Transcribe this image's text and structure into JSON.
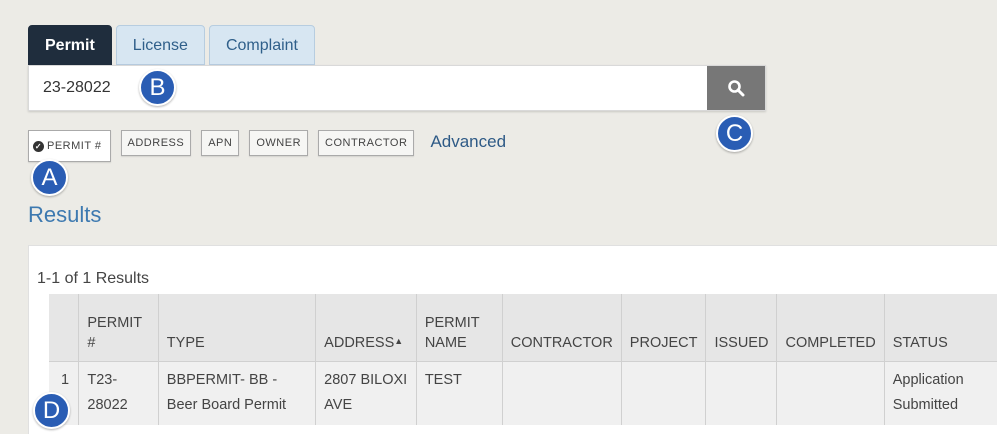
{
  "tabs": [
    {
      "label": "Permit",
      "active": true
    },
    {
      "label": "License",
      "active": false
    },
    {
      "label": "Complaint",
      "active": false
    }
  ],
  "search": {
    "value": "23-28022",
    "button_icon": "search-icon"
  },
  "filters": {
    "chips": [
      "PERMIT #",
      "ADDRESS",
      "APN",
      "OWNER",
      "CONTRACTOR"
    ],
    "active_chip": "PERMIT #",
    "advanced_label": "Advanced"
  },
  "results": {
    "heading": "Results",
    "count_text": "1-1 of 1 Results",
    "columns": [
      "PERMIT #",
      "TYPE",
      "ADDRESS",
      "PERMIT NAME",
      "CONTRACTOR",
      "PROJECT",
      "ISSUED",
      "COMPLETED",
      "STATUS"
    ],
    "rows": [
      {
        "num": "1",
        "permit": "T23-28022",
        "type": "BBPERMIT- BB - Beer Board Permit",
        "address": "2807 BILOXI AVE",
        "permit_name": "TEST",
        "contractor": "",
        "project": "",
        "issued": "",
        "completed": "",
        "status": "Application Submitted"
      }
    ]
  },
  "callouts": {
    "a": "A",
    "b": "B",
    "c": "C",
    "d": "D"
  },
  "colors": {
    "active_tab": "#1f2d3d",
    "callout": "#2a5db4",
    "link": "#2e5a86"
  }
}
